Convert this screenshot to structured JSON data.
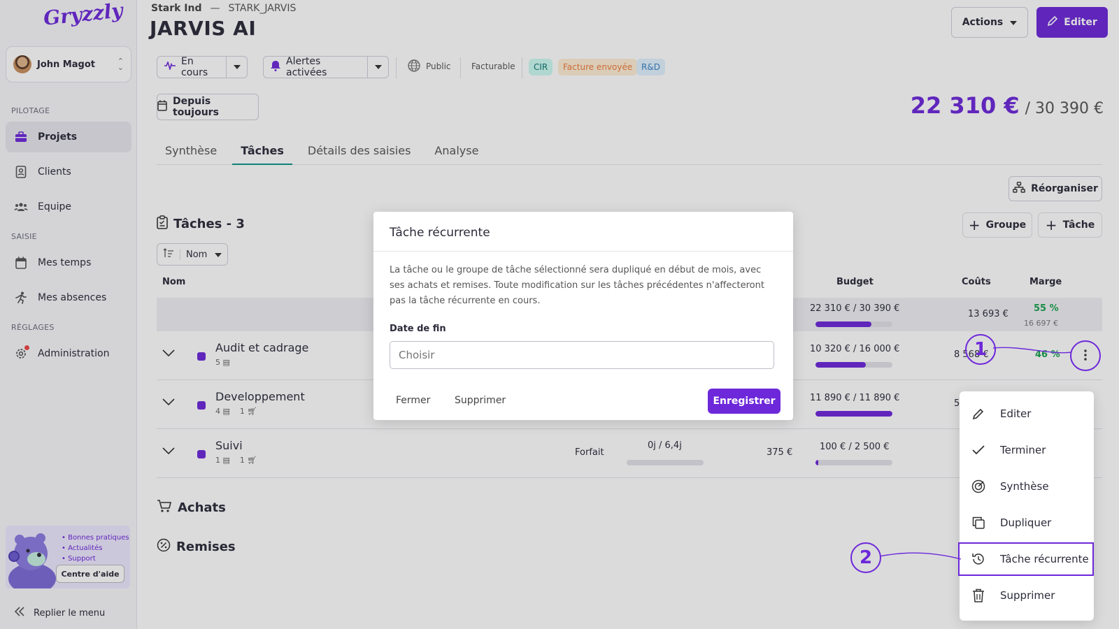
{
  "sidebar": {
    "logo": "Gryzzly",
    "user": "John Magot",
    "sections": [
      "PILOTAGE",
      "SAISIE",
      "RÉGLAGES"
    ],
    "items": [
      {
        "label": "Projets"
      },
      {
        "label": "Clients"
      },
      {
        "label": "Equipe"
      },
      {
        "label": "Mes temps"
      },
      {
        "label": "Mes absences"
      },
      {
        "label": "Administration"
      }
    ],
    "help": {
      "bullets": [
        "• Bonnes pratiques",
        "• Actualités",
        "• Support"
      ],
      "button": "Centre d'aide"
    },
    "collapse_label": "Replier le menu"
  },
  "header": {
    "client": "Stark Ind",
    "separator": "—",
    "code": "STARK_JARVIS",
    "title": "JARVIS AI",
    "actions_label": "Actions",
    "edit_label": "Editer"
  },
  "status_bar": {
    "status": "En cours",
    "alerts": "Alertes activées",
    "visibility": "Public",
    "billing": "Facturable",
    "tags": [
      {
        "label": "CIR",
        "bg": "#ccfbf1",
        "color": "#0f766e"
      },
      {
        "label": "Facture envoyée",
        "bg": "#ffedd5",
        "color": "#ea7c3a"
      },
      {
        "label": "R&D",
        "bg": "#e0f2fe",
        "color": "#3b82c4"
      }
    ]
  },
  "period_label": "Depuis toujours",
  "amount": {
    "current": "22 310 €",
    "total": "/ 30 390 €"
  },
  "tabs": [
    {
      "label": "Synthèse"
    },
    {
      "label": "Tâches"
    },
    {
      "label": "Détails des saisies"
    },
    {
      "label": "Analyse"
    }
  ],
  "reorganize_label": "Réorganiser",
  "tasks": {
    "title": "Tâches - 3",
    "add_group": "Groupe",
    "add_task": "Tâche",
    "sort_label": "Nom",
    "columns": {
      "name": "Nom",
      "budget": "Budget",
      "costs": "Coûts",
      "margin": "Marge"
    },
    "summary": {
      "budget": "22 310 € / 30 390 €",
      "budget_progress": 0.73,
      "costs": "13 693 €",
      "margin_pct": "55 %",
      "margin_val": "16 697 €"
    },
    "rows": [
      {
        "name": "Audit et cadrage",
        "tasks_count": "5",
        "purchases_count": "",
        "type": "",
        "days": "",
        "days_progress": 0,
        "amount": "",
        "budget": "10 320 € / 16 000 €",
        "budget_progress": 0.65,
        "costs": "8 568 €",
        "margin": "46 %"
      },
      {
        "name": "Developpement",
        "tasks_count": "4",
        "purchases_count": "1",
        "type": "",
        "days": "",
        "days_progress": 0,
        "amount": "",
        "budget": "11 890 € / 11 890 €",
        "budget_progress": 1.0,
        "costs": "5",
        "margin": ""
      },
      {
        "name": "Suivi",
        "tasks_count": "1",
        "purchases_count": "1",
        "type": "Forfait",
        "days": "0j / 6,4j",
        "days_progress": 0,
        "amount": "375 €",
        "budget": "100 € / 2 500 €",
        "budget_progress": 0.04,
        "costs": "",
        "margin": ""
      }
    ]
  },
  "purchases_title": "Achats",
  "discounts_title": "Remises",
  "modal": {
    "title": "Tâche récurrente",
    "description": "La tâche ou le groupe de tâche sélectionné sera dupliqué en début de mois, avec ses achats et remises. Toute modification sur les tâches précédentes n'affecteront pas la tâche récurrente en cours.",
    "date_label": "Date de fin",
    "date_placeholder": "Choisir",
    "close": "Fermer",
    "delete": "Supprimer",
    "save": "Enregistrer"
  },
  "context_menu": [
    {
      "label": "Editer",
      "icon": "pencil-icon"
    },
    {
      "label": "Terminer",
      "icon": "check-icon"
    },
    {
      "label": "Synthèse",
      "icon": "target-icon"
    },
    {
      "label": "Dupliquer",
      "icon": "copy-icon"
    },
    {
      "label": "Tâche récurrente",
      "icon": "history-icon"
    },
    {
      "label": "Supprimer",
      "icon": "trash-icon"
    }
  ],
  "callouts": [
    "1",
    "2"
  ],
  "colors": {
    "accent": "#6d28d9",
    "tab_underline": "#0d9488",
    "positive": "#16a34a"
  }
}
